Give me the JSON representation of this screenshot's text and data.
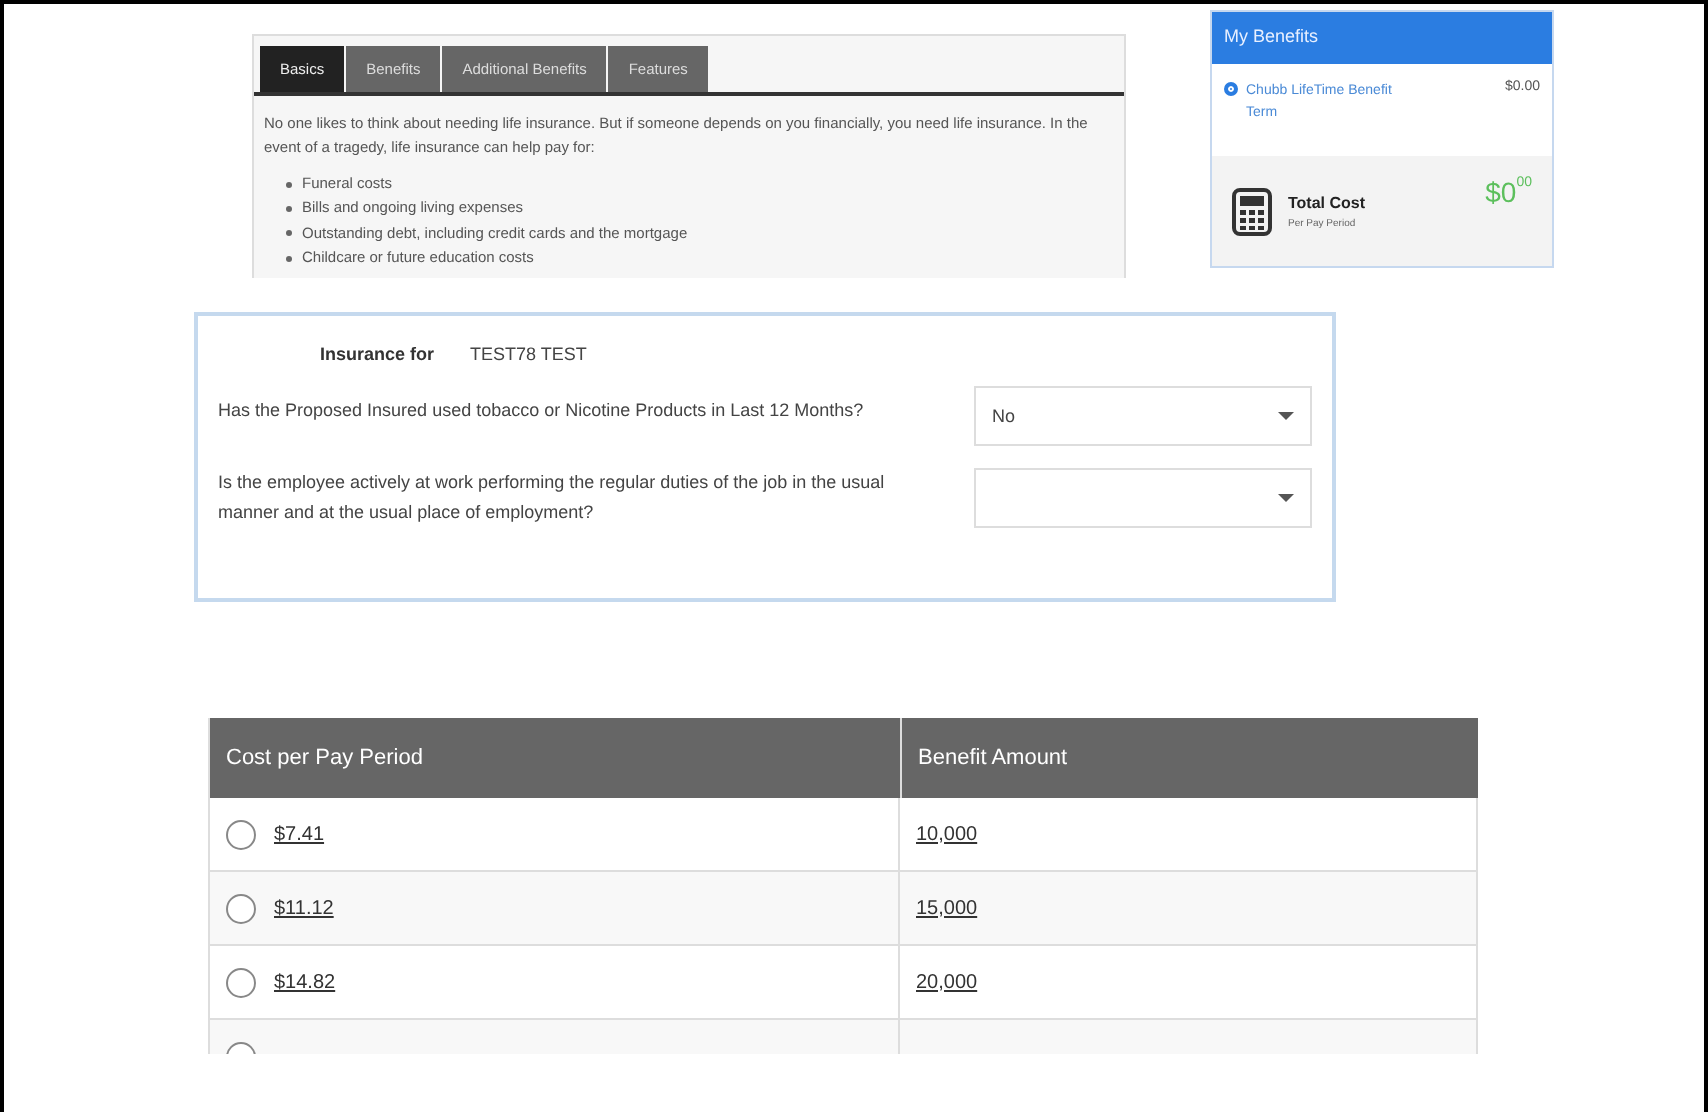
{
  "tabs": [
    {
      "label": "Basics",
      "selected": true
    },
    {
      "label": "Benefits",
      "selected": false
    },
    {
      "label": "Additional Benefits",
      "selected": false
    },
    {
      "label": "Features",
      "selected": false
    }
  ],
  "intro": "No one likes to think about needing life insurance. But if someone depends on you financially, you need life insurance. In the event of a tragedy, life insurance can help pay for:",
  "bullets": [
    "Funeral costs",
    "Bills and ongoing living expenses",
    "Outstanding debt, including credit cards and the mortgage",
    "Childcare or future education costs"
  ],
  "my_benefits": {
    "title": "My Benefits",
    "items": [
      {
        "name": "Chubb LifeTime Benefit Term",
        "amount": "$0.00",
        "selected": true
      }
    ],
    "total": {
      "label": "Total Cost",
      "sublabel": "Per Pay Period",
      "amount": "$0",
      "cents": "00"
    }
  },
  "form": {
    "insured_label": "Insurance for",
    "insured_name": "TEST78 TEST",
    "questions": [
      {
        "text": "Has the Proposed Insured used tobacco or Nicotine Products in Last 12 Months?",
        "value": "No"
      },
      {
        "text": "Is the employee actively at work performing the regular duties of the job in the usual manner and at the usual place of employment?"
      }
    ]
  },
  "table": {
    "columns": [
      "Cost per Pay Period",
      "Benefit Amount"
    ],
    "rows": [
      {
        "cost": "$7.41",
        "benefit": "10,000",
        "selected": false
      },
      {
        "cost": "$11.12",
        "benefit": "15,000",
        "selected": false
      },
      {
        "cost": "$14.82",
        "benefit": "20,000",
        "selected": false
      },
      {
        "selected": false
      }
    ]
  }
}
